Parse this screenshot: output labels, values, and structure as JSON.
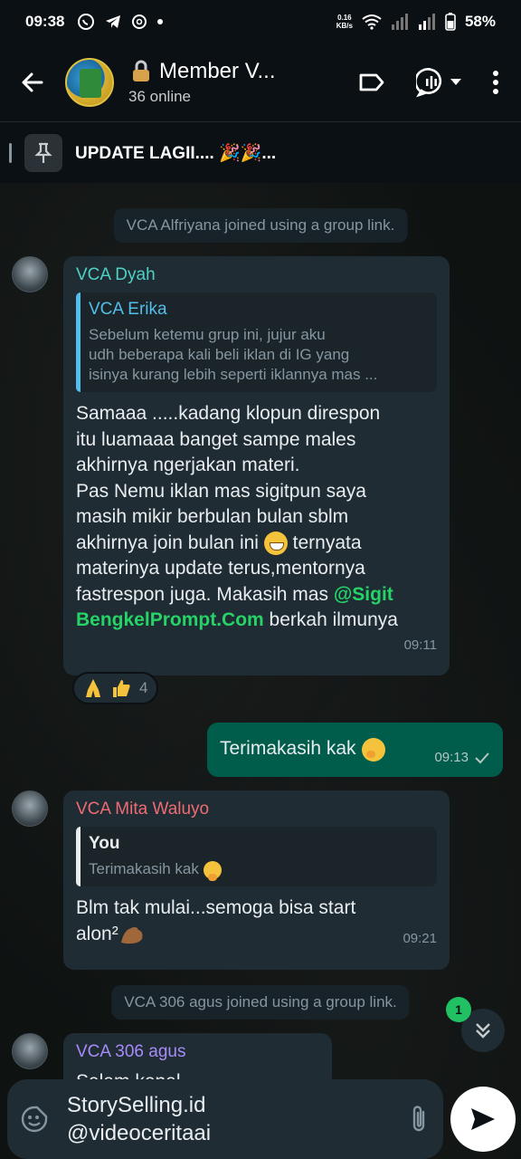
{
  "status_bar": {
    "time": "09:38",
    "net_speed_value": "0.16",
    "net_speed_unit": "KB/s",
    "battery": "58%"
  },
  "header": {
    "title": "Member V...",
    "subtitle": "36 online"
  },
  "pinned": {
    "text": "UPDATE LAGII.... 🎉🎉..."
  },
  "system_messages": [
    "VCA Alfriyana joined using a group link.",
    "VCA 306 agus joined using a group link."
  ],
  "messages": {
    "dyah": {
      "sender": "VCA Dyah",
      "quote_name": "VCA Erika",
      "quote_text": "Sebelum ketemu grup ini, jujur aku\nudh beberapa kali beli iklan  di IG yang\nisinya kurang lebih seperti iklannya mas ...",
      "text_1": "Samaaa .....kadang klopun direspon\nitu luamaaa banget sampe males\nakhirnya ngerjakan materi.\nPas Nemu iklan mas sigitpun saya\nmasih mikir berbulan bulan sblm\nakhirnya join bulan ini",
      "text_2": " ternyata\nmaterinya update terus,mentornya\nfastrespon juga. Makasih mas ",
      "mention": "@Sigit\nBengkelPrompt.Com",
      "text_3": " berkah ilmunya",
      "time": "09:11",
      "reaction_count": "4"
    },
    "outgoing": {
      "text": "Terimakasih kak",
      "time": "09:13"
    },
    "mita": {
      "sender": "VCA Mita Waluyo",
      "quote_name": "You",
      "quote_text": "Terimakasih kak",
      "text": "Blm tak mulai...semoga bisa start\nalon²",
      "time": "09:21"
    },
    "agus": {
      "sender": "VCA 306 agus",
      "text": "Salam kenal"
    }
  },
  "scroll": {
    "unread": "1"
  },
  "input": {
    "value": "StorySelling.id\n@videoceritaai"
  }
}
